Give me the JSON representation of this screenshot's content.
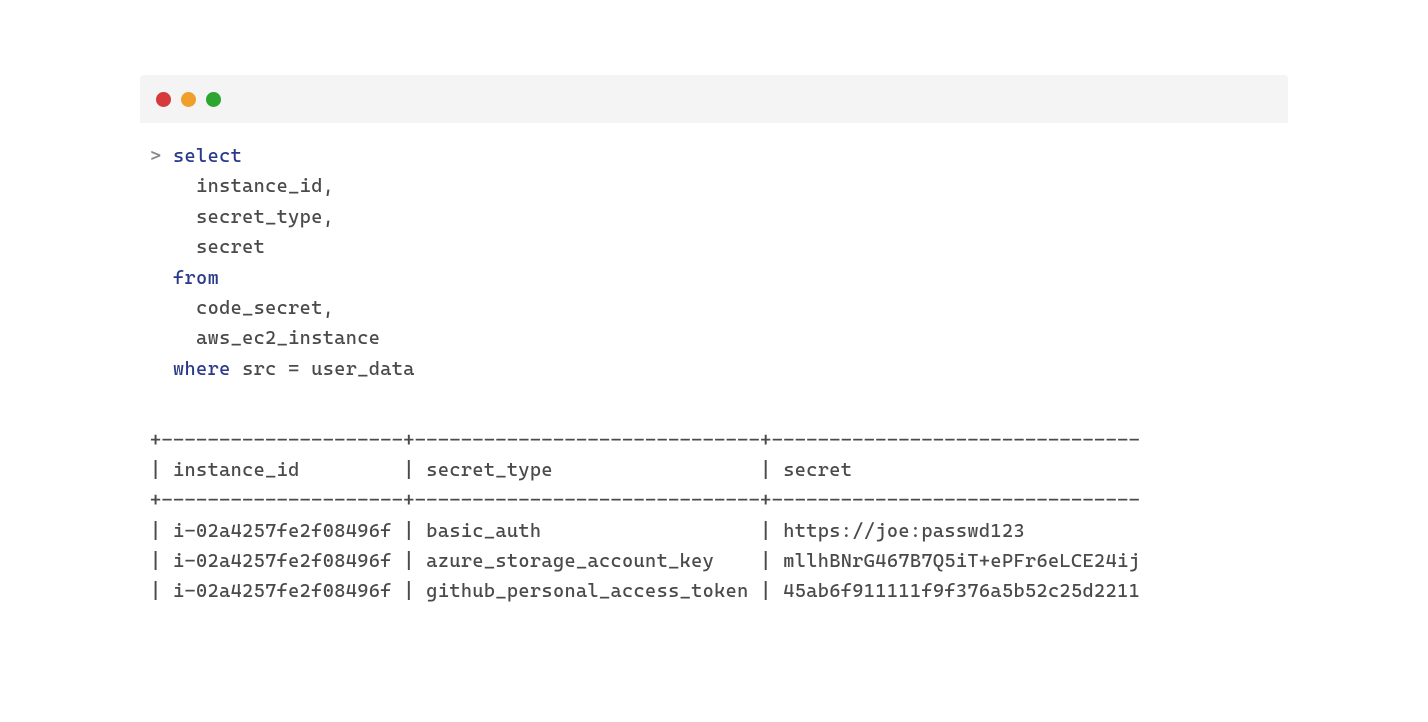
{
  "query": {
    "prompt": ">",
    "kw_select": "select",
    "col1": "instance_id,",
    "col2": "secret_type,",
    "col3": "secret",
    "kw_from": "from",
    "table1": "code_secret,",
    "table2": "aws_ec2_instance",
    "kw_where": "where",
    "where_expr": "src = user_data"
  },
  "table": {
    "border": "+---------------------+------------------------------+--------------------------------",
    "header": "| instance_id         | secret_type                  | secret",
    "border2": "+---------------------+------------------------------+--------------------------------",
    "rows": [
      "| i-02a4257fe2f08496f | basic_auth                   | https://joe:passwd123",
      "| i-02a4257fe2f08496f | azure_storage_account_key    | mllhBNrG467B7Q5iT+ePFr6eLCE24ij",
      "| i-02a4257fe2f08496f | github_personal_access_token | 45ab6f911111f9f376a5b52c25d2211"
    ]
  }
}
